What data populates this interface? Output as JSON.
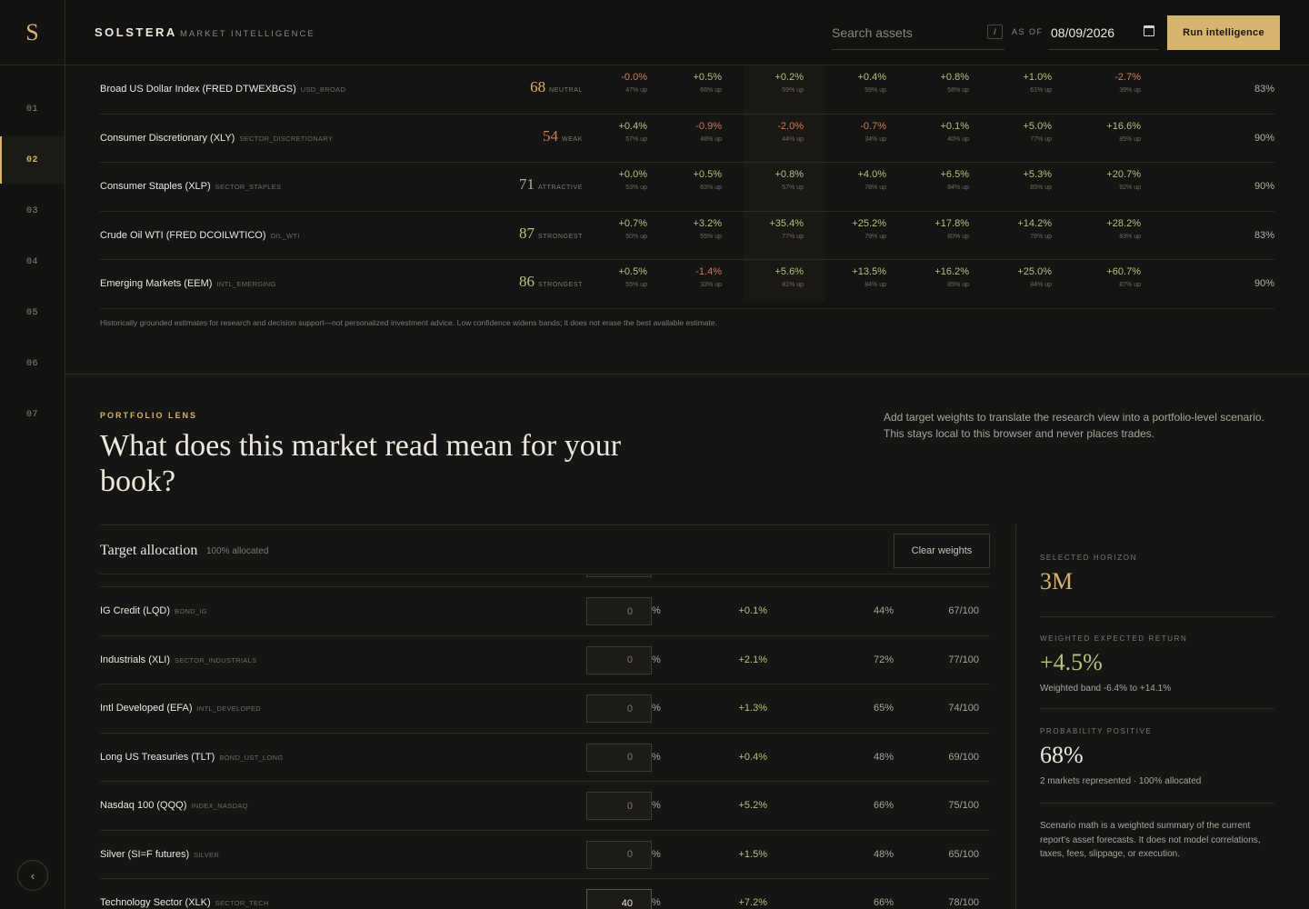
{
  "app": {
    "logo": "S",
    "brand": "SOLSTERA",
    "brand_sub": "MARKET INTELLIGENCE"
  },
  "header": {
    "search_placeholder": "Search assets",
    "slash_key": "/",
    "asof_label": "AS OF",
    "date": "08/09/2026",
    "run_button": "Run intelligence"
  },
  "nav": {
    "items": [
      "01",
      "02",
      "03",
      "04",
      "05",
      "06",
      "07"
    ],
    "active": "02",
    "collapse_icon": "‹"
  },
  "forecast": {
    "rows": [
      {
        "name": "Broad US Dollar Index (FRED DTWEXBGS)",
        "code": "USD_BROAD",
        "score": "68",
        "score_label": "NEUTRAL",
        "tone": "neutral",
        "cells": [
          [
            "-0.0%",
            "47% up"
          ],
          [
            "+0.5%",
            "66% up"
          ],
          [
            "+0.2%",
            "59% up"
          ],
          [
            "+0.4%",
            "59% up"
          ],
          [
            "+0.8%",
            "58% up"
          ],
          [
            "+1.0%",
            "61% up"
          ],
          [
            "-2.7%",
            "39% up"
          ]
        ],
        "confidence": "83%"
      },
      {
        "name": "Consumer Discretionary (XLY)",
        "code": "SECTOR_DISCRETIONARY",
        "score": "54",
        "score_label": "WEAK",
        "tone": "weak",
        "cells": [
          [
            "+0.4%",
            "57% up"
          ],
          [
            "-0.9%",
            "48% up"
          ],
          [
            "-2.0%",
            "44% up"
          ],
          [
            "-0.7%",
            "34% up"
          ],
          [
            "+0.1%",
            "40% up"
          ],
          [
            "+5.0%",
            "77% up"
          ],
          [
            "+16.6%",
            "85% up"
          ]
        ],
        "confidence": "90%"
      },
      {
        "name": "Consumer Staples (XLP)",
        "code": "SECTOR_STAPLES",
        "score": "71",
        "score_label": "ATTRACTIVE",
        "tone": "attractive",
        "cells": [
          [
            "+0.0%",
            "53% up"
          ],
          [
            "+0.5%",
            "63% up"
          ],
          [
            "+0.8%",
            "57% up"
          ],
          [
            "+4.0%",
            "78% up"
          ],
          [
            "+6.5%",
            "84% up"
          ],
          [
            "+5.3%",
            "85% up"
          ],
          [
            "+20.7%",
            "92% up"
          ]
        ],
        "confidence": "90%"
      },
      {
        "name": "Crude Oil WTI (FRED DCOILWTICO)",
        "code": "OIL_WTI",
        "score": "87",
        "score_label": "STRONGEST",
        "tone": "strong",
        "cells": [
          [
            "+0.7%",
            "50% up"
          ],
          [
            "+3.2%",
            "55% up"
          ],
          [
            "+35.4%",
            "77% up"
          ],
          [
            "+25.2%",
            "79% up"
          ],
          [
            "+17.8%",
            "80% up"
          ],
          [
            "+14.2%",
            "76% up"
          ],
          [
            "+28.2%",
            "83% up"
          ]
        ],
        "confidence": "83%"
      },
      {
        "name": "Emerging Markets (EEM)",
        "code": "INTL_EMERGING",
        "score": "86",
        "score_label": "STRONGEST",
        "tone": "strong",
        "cells": [
          [
            "+0.5%",
            "55% up"
          ],
          [
            "-1.4%",
            "33% up"
          ],
          [
            "+5.6%",
            "81% up"
          ],
          [
            "+13.5%",
            "84% up"
          ],
          [
            "+16.2%",
            "85% up"
          ],
          [
            "+25.0%",
            "84% up"
          ],
          [
            "+60.7%",
            "87% up"
          ]
        ],
        "confidence": "90%"
      }
    ],
    "disclaimer": "Historically grounded estimates for research and decision support—not personalized investment advice. Low confidence widens bands; it does not erase the best available estimate."
  },
  "lens": {
    "eyebrow": "PORTFOLIO LENS",
    "title": "What does this market read mean for your book?",
    "description": "Add target weights to translate the research view into a portfolio-level scenario. This stays local to this browser and never places trades."
  },
  "allocation": {
    "title": "Target allocation",
    "subtitle": "100% allocated",
    "clear_button": "Clear weights",
    "rows": [
      {
        "name": "IG Credit (LQD)",
        "code": "BOND_IG",
        "weight": "0",
        "ret": "+0.1%",
        "prob": "44%",
        "score": "67/100"
      },
      {
        "name": "Industrials (XLI)",
        "code": "SECTOR_INDUSTRIALS",
        "weight": "0",
        "ret": "+2.1%",
        "prob": "72%",
        "score": "77/100"
      },
      {
        "name": "Intl Developed (EFA)",
        "code": "INTL_DEVELOPED",
        "weight": "0",
        "ret": "+1.3%",
        "prob": "65%",
        "score": "74/100"
      },
      {
        "name": "Long US Treasuries (TLT)",
        "code": "BOND_UST_LONG",
        "weight": "0",
        "ret": "+0.4%",
        "prob": "48%",
        "score": "69/100"
      },
      {
        "name": "Nasdaq 100 (QQQ)",
        "code": "INDEX_NASDAQ",
        "weight": "0",
        "ret": "+5.2%",
        "prob": "66%",
        "score": "75/100"
      },
      {
        "name": "Silver (SI=F futures)",
        "code": "SILVER",
        "weight": "0",
        "ret": "+1.5%",
        "prob": "48%",
        "score": "65/100"
      },
      {
        "name": "Technology Sector (XLK)",
        "code": "SECTOR_TECH",
        "weight": "40",
        "ret": "+7.2%",
        "prob": "66%",
        "score": "78/100"
      }
    ],
    "pct": "%"
  },
  "summary": {
    "horizon_label": "SELECTED HORIZON",
    "horizon": "3M",
    "return_label": "WEIGHTED EXPECTED RETURN",
    "return_value": "+4.5%",
    "return_note": "Weighted band -6.4% to +14.1%",
    "prob_label": "PROBABILITY POSITIVE",
    "prob_value": "68%",
    "prob_note": "2 markets represented · 100% allocated",
    "footnote": "Scenario math is a weighted summary of the current report's asset forecasts. It does not model correlations, taxes, fees, slippage, or execution."
  }
}
